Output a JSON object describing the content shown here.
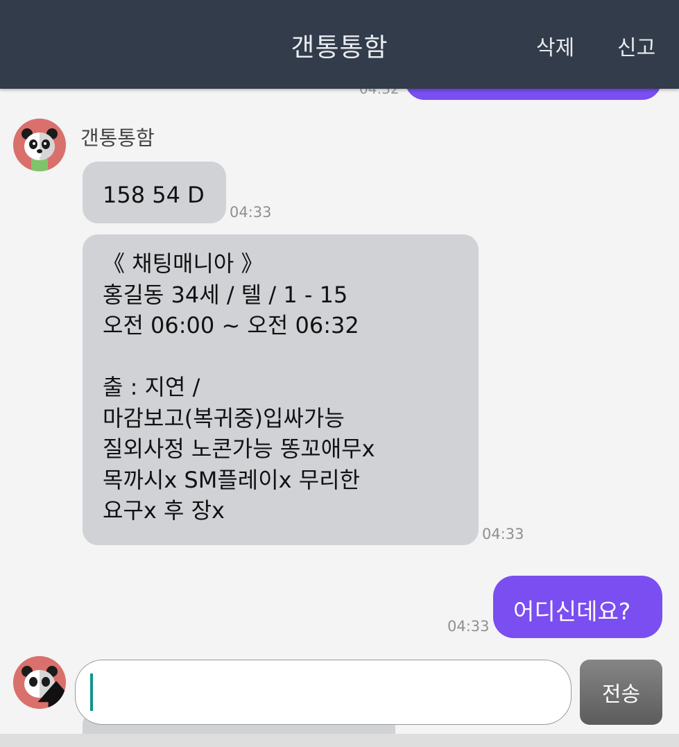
{
  "header": {
    "title": "갠통통함",
    "delete_label": "삭제",
    "report_label": "신고"
  },
  "previous_message": {
    "time": "04:32"
  },
  "sender": {
    "name": "갠통통함"
  },
  "messages": [
    {
      "direction": "in",
      "text": "158 54 D",
      "time": "04:33"
    },
    {
      "direction": "in",
      "text": "《 채팅매니아 》\n홍길동 34세 / 텔 / 1 - 15\n오전 06:00 ~ 오전 06:32\n\n출 : 지연 /\n마감보고(복귀중)입싸가능\n질외사정 노콘가능 똥꼬애무x\n목까시x SM플레이x 무리한\n요구x 후 장x",
      "time": "04:33"
    },
    {
      "direction": "out",
      "text": "어디신데요?",
      "time": "04:33"
    }
  ],
  "composer": {
    "placeholder": "",
    "value": "",
    "send_label": "전송"
  },
  "colors": {
    "header_bg": "#323c4b",
    "outgoing_bubble": "#7a4ef0",
    "incoming_bubble": "#d0d2d6",
    "avatar_bg": "#d9706c"
  },
  "icons": {
    "avatar": "panda-avatar-icon",
    "upload": "upload-arrow-icon"
  }
}
